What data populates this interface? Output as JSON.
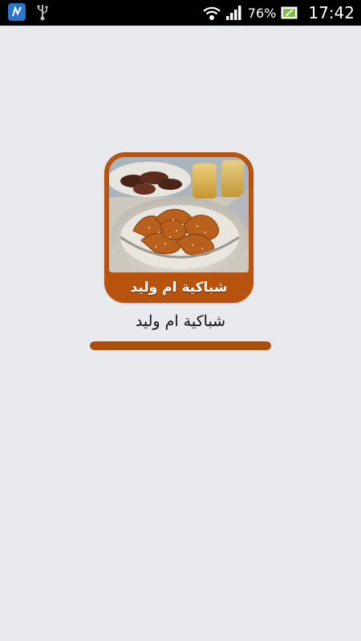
{
  "status_bar": {
    "battery_percent": "76%",
    "time": "17:42",
    "icons": {
      "notification": "notification-app-icon",
      "usb": "usb-icon",
      "wifi": "wifi-icon",
      "signal": "signal-icon",
      "battery": "battery-charging-icon"
    }
  },
  "splash": {
    "icon_banner_text": "شباكية ام وليد",
    "app_name": "شباكية ام وليد",
    "progress_fraction": 1.0
  },
  "colors": {
    "background": "#e9eaee",
    "accent": "#b8520f",
    "progress": "#a84f10"
  }
}
